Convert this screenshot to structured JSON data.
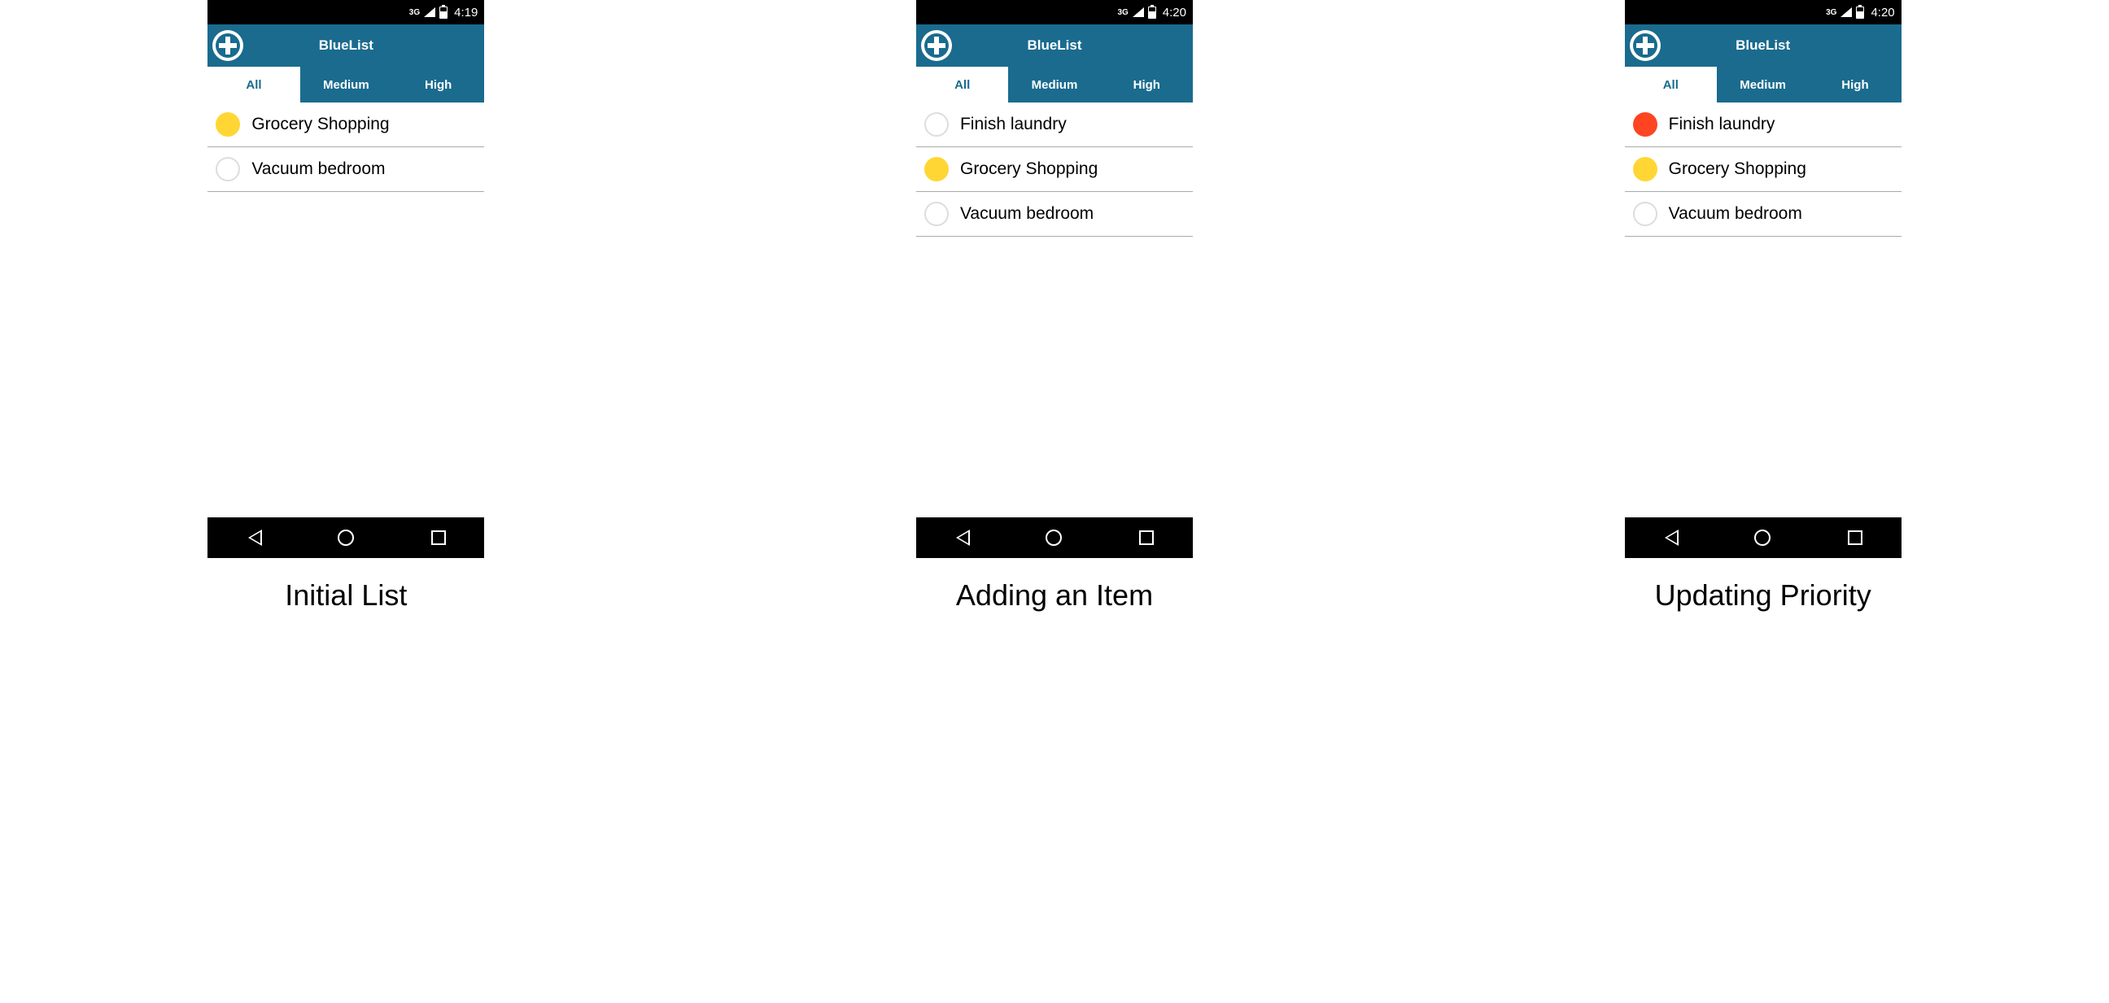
{
  "app_title": "BlueList",
  "tabs": {
    "all": "All",
    "medium": "Medium",
    "high": "High"
  },
  "colors": {
    "header_bg": "#1a6b8e",
    "priority_medium": "#ffd633",
    "priority_high": "#ff4422",
    "priority_none_border": "#dddddd"
  },
  "screens": [
    {
      "status_time": "4:19",
      "network": "3G",
      "caption": "Initial List",
      "items": [
        {
          "text": "Grocery Shopping",
          "priority": "medium"
        },
        {
          "text": "Vacuum bedroom",
          "priority": "none"
        }
      ]
    },
    {
      "status_time": "4:20",
      "network": "3G",
      "caption": "Adding an Item",
      "items": [
        {
          "text": "Finish laundry",
          "priority": "none"
        },
        {
          "text": "Grocery Shopping",
          "priority": "medium"
        },
        {
          "text": "Vacuum bedroom",
          "priority": "none"
        }
      ]
    },
    {
      "status_time": "4:20",
      "network": "3G",
      "caption": "Updating Priority",
      "items": [
        {
          "text": "Finish laundry",
          "priority": "high"
        },
        {
          "text": "Grocery Shopping",
          "priority": "medium"
        },
        {
          "text": "Vacuum bedroom",
          "priority": "none"
        }
      ]
    }
  ]
}
